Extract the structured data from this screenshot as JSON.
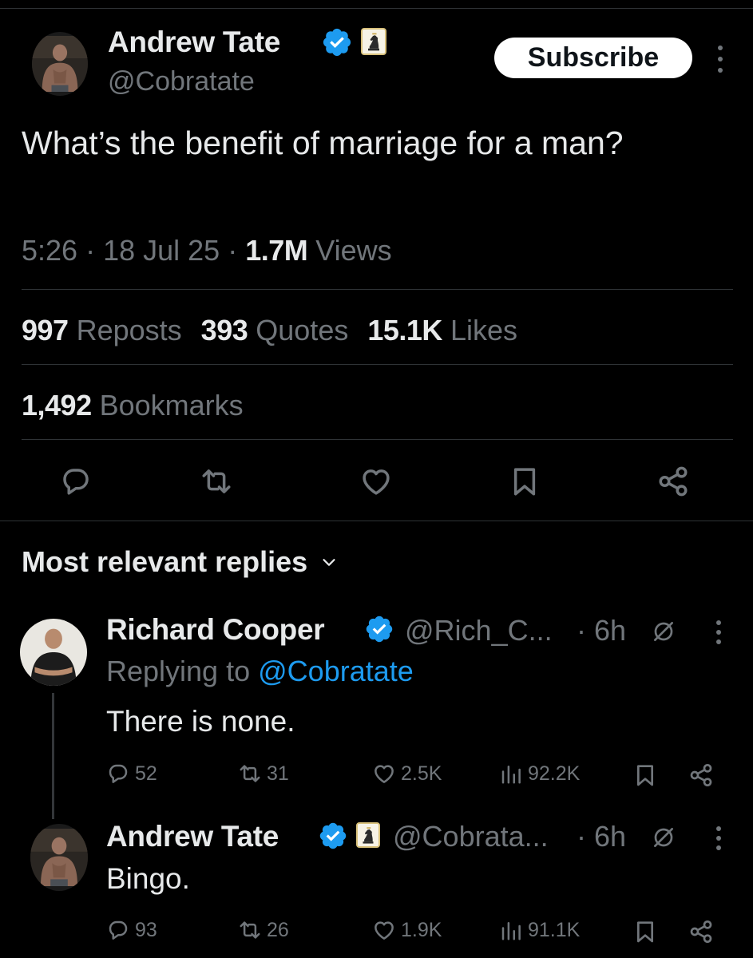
{
  "tweet": {
    "author_name": "Andrew Tate",
    "author_handle": "@Cobratate",
    "subscribe_label": "Subscribe",
    "text": "What’s the benefit of marriage for a man?",
    "time": "5:26",
    "date": "18 Jul 25",
    "views_count": "1.7M",
    "views_label": "Views",
    "reposts_count": "997",
    "reposts_label": "Reposts",
    "quotes_count": "393",
    "quotes_label": "Quotes",
    "likes_count": "15.1K",
    "likes_label": "Likes",
    "bookmarks_count": "1,492",
    "bookmarks_label": "Bookmarks",
    "actions": [
      "reply-icon",
      "repost-icon",
      "like-icon",
      "bookmark-icon",
      "share-icon"
    ]
  },
  "replies_section": {
    "title": "Most relevant replies",
    "sort_icon": "chevron-down-icon"
  },
  "replies": [
    {
      "name": "Richard Cooper",
      "handle": "@Rich_C...",
      "time": "· 6h",
      "replying_prefix": "Replying to",
      "replying_to": "@Cobratate",
      "text": "There is none.",
      "reply_count": "52",
      "repost_count": "31",
      "like_count": "2.5K",
      "view_count": "92.2K"
    },
    {
      "name": "Andrew Tate",
      "handle": "@Cobrata...",
      "time": "· 6h",
      "text": "Bingo.",
      "reply_count": "93",
      "repost_count": "26",
      "like_count": "1.9K",
      "view_count": "91.1K"
    }
  ],
  "colors": {
    "background": "#000000",
    "text_primary": "#e7e9ea",
    "text_secondary": "#71767b",
    "accent": "#1d9bf0",
    "divider": "#2f3336"
  }
}
